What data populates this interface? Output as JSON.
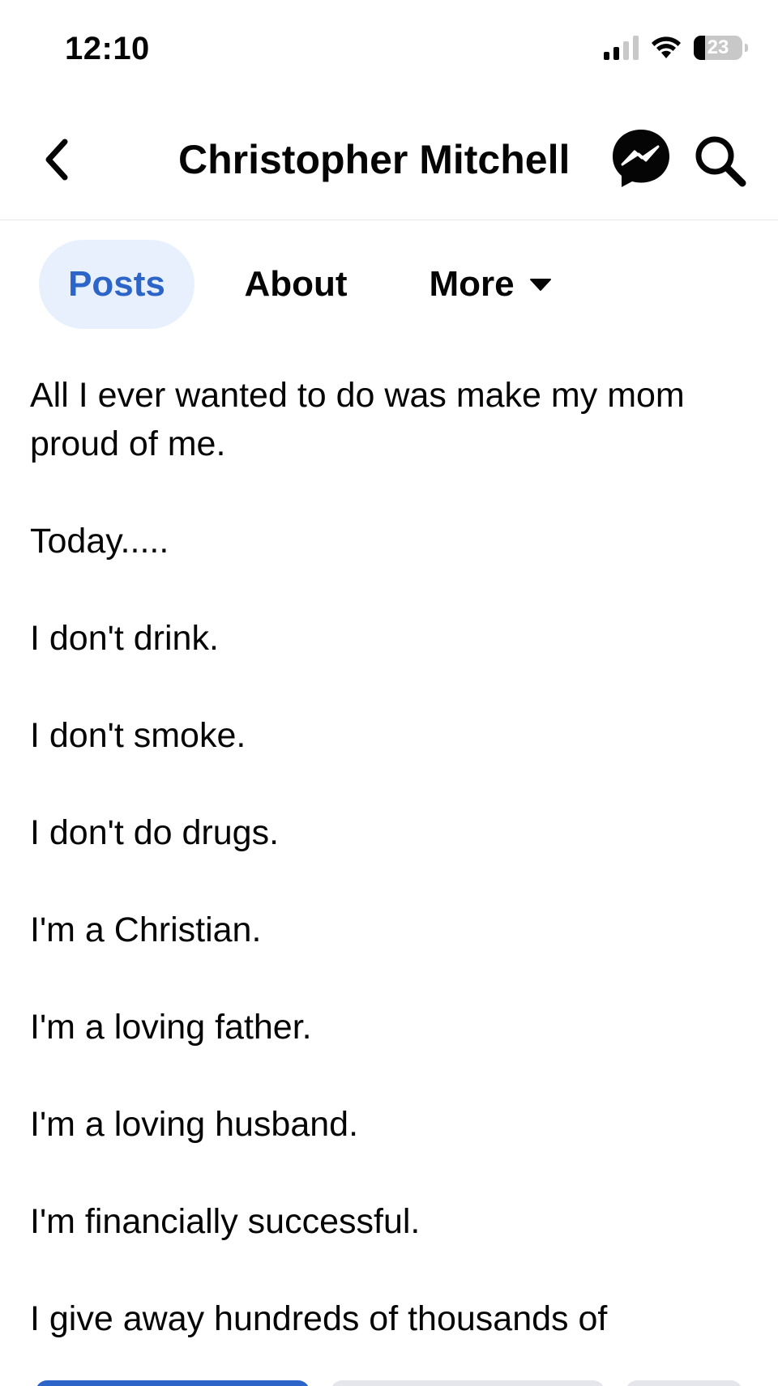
{
  "status_bar": {
    "time": "12:10",
    "battery_level": "23",
    "icons": [
      "cellular-signal-icon",
      "wifi-icon",
      "battery-icon"
    ]
  },
  "header": {
    "title": "Christopher Mitchell",
    "icons": [
      "back-chevron-icon",
      "messenger-icon",
      "search-icon"
    ]
  },
  "tabs": [
    {
      "label": "Posts",
      "selected": true
    },
    {
      "label": "About",
      "selected": false
    },
    {
      "label": "More",
      "selected": false,
      "icon": "caret-down-icon"
    }
  ],
  "post": {
    "lines": [
      "All I ever wanted to do was make my mom proud of me.",
      "Today.....",
      "I don't drink.",
      "I don't smoke.",
      "I don't do drugs.",
      "I'm a Christian.",
      "I'm a loving father.",
      "I'm a loving husband.",
      "I'm financially successful.",
      "I give away hundreds of thousands of"
    ]
  },
  "colors": {
    "accent": "#2d64c8",
    "tab_selected_bg": "#e7f0fc",
    "text": "#050505",
    "divider": "#e4e6eb",
    "primary_button": "#2d64c8",
    "secondary_button": "#e4e6eb"
  }
}
